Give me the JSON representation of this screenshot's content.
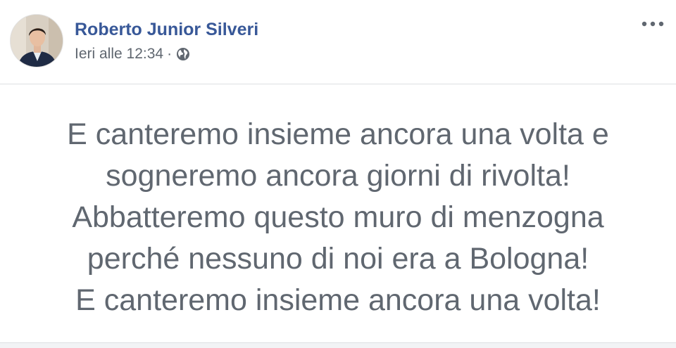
{
  "post": {
    "author": "Roberto Junior Silveri",
    "timestamp": "Ieri alle 12:34",
    "separator": "·",
    "privacy_icon": "globe-icon",
    "more_icon": "more-options-icon",
    "lines": [
      "E canteremo insieme ancora una volta e",
      "sogneremo ancora giorni di rivolta!",
      "Abbatteremo questo muro di menzogna",
      "perché nessuno di noi era a Bologna!",
      "E canteremo insieme ancora una volta!"
    ]
  },
  "colors": {
    "author_link": "#385898",
    "meta_text": "#606770",
    "body_text": "#606770",
    "divider": "#dddfe2"
  }
}
